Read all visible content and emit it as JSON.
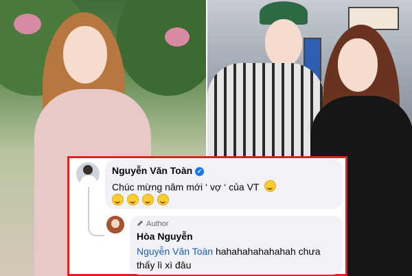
{
  "comment_1": {
    "author": "Nguyễn Văn Toàn",
    "text": "Chúc mừng năm mới ‘ vợ ‘ của VT",
    "emoji_line": [
      "grinning-squinting-face-emoji",
      "grinning-squinting-face-emoji",
      "grinning-squinting-face-emoji",
      "grinning-squinting-face-emoji"
    ]
  },
  "comment_2": {
    "badge": "Author",
    "author": "Hòa Nguyễn",
    "mention": "Nguyễn Văn Toàn",
    "text_line1": " hahahahahahahah chưa",
    "text_line2": "thấy lì xì đâu"
  },
  "colors": {
    "highlight_border": "#e02020",
    "verified_badge": "#1877f2",
    "mention_link": "#1c5bb8",
    "bubble_bg": "#f0f2f5"
  }
}
